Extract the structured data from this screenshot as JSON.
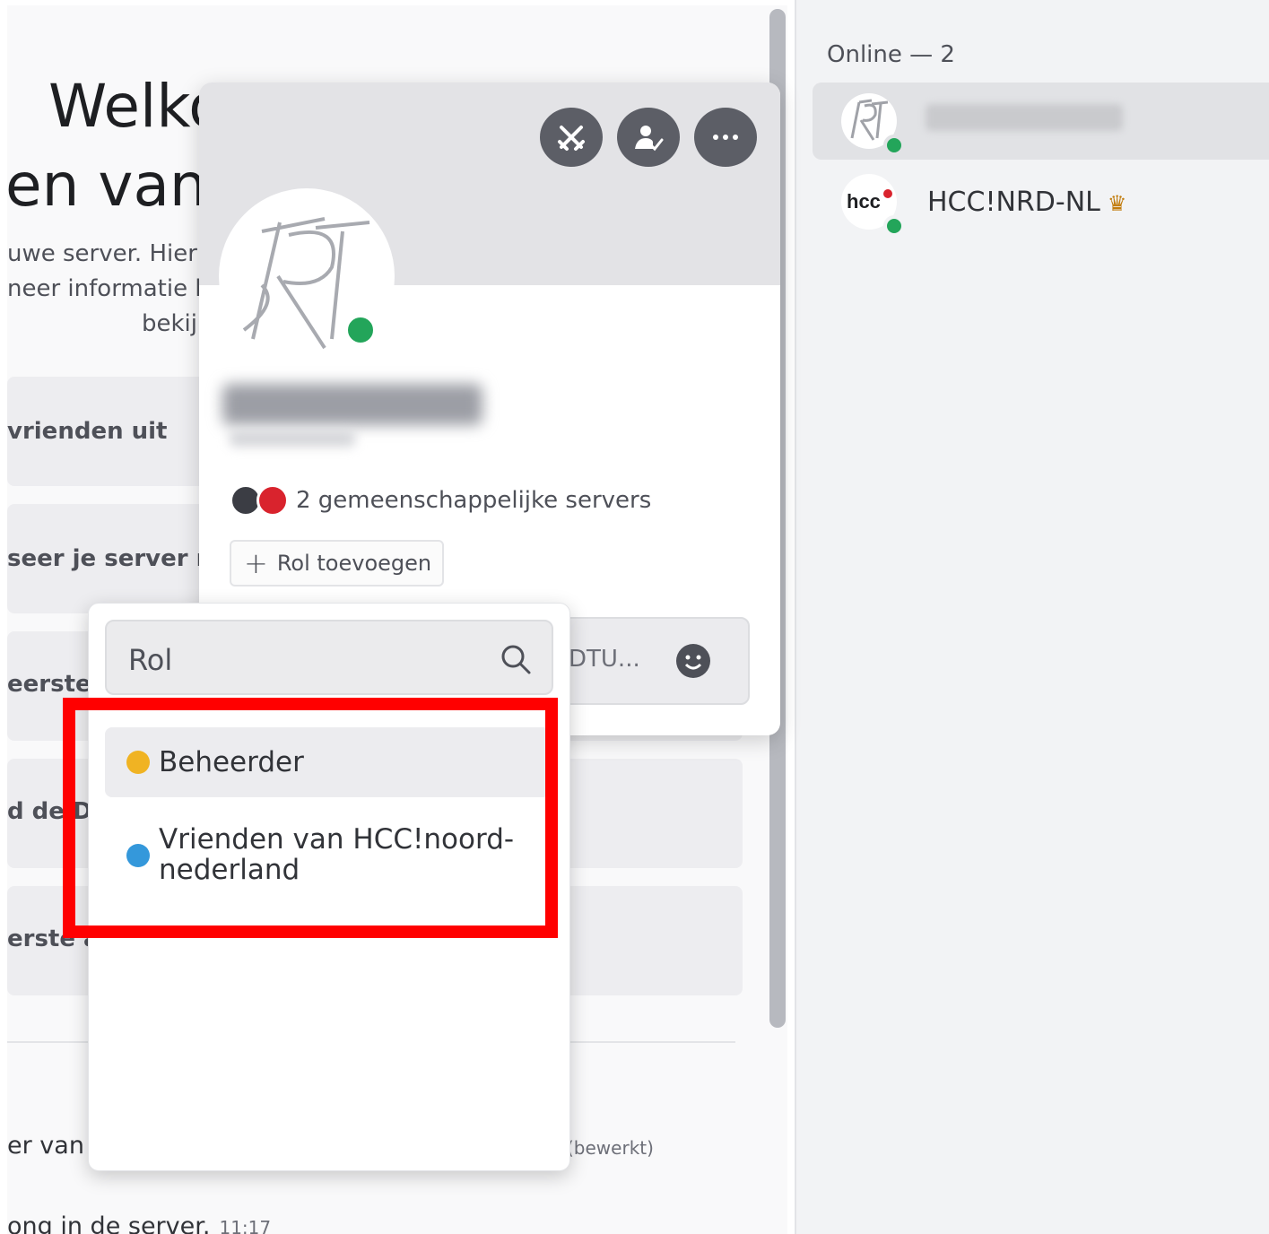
{
  "main": {
    "welcome_title_line1": "Welko",
    "welcome_title_line2": "en van l",
    "welcome_desc_line1": "uwe server. Hier v",
    "welcome_desc_line2": "neer informatie k",
    "welcome_desc_line3": "bekijl",
    "cards": [
      {
        "label": "vrienden uit"
      },
      {
        "label": "seer je server m"
      },
      {
        "label": "eerste b"
      },
      {
        "label": "d de Dis"
      },
      {
        "label": "erste a"
      }
    ],
    "message_line1": "er van",
    "edited_label": "(bewerkt)",
    "message_line2": "ong in de server.",
    "message_time": "11:17"
  },
  "member_list": {
    "header": "Online — 2",
    "members": [
      {
        "name": "",
        "avatar_icon": "kt-logo-avatar",
        "status": "online",
        "selected": true
      },
      {
        "name": "HCC!NRD-NL",
        "avatar_icon": "hcc-logo-avatar",
        "status": "online",
        "owner_icon": "crown-icon"
      }
    ]
  },
  "profile": {
    "buttons": [
      {
        "icon": "swords-icon"
      },
      {
        "icon": "person-check-icon"
      },
      {
        "icon": "more-icon"
      }
    ],
    "mutual_servers": "2 gemeenschappelijke servers",
    "add_role_plus": "+",
    "add_role_label": "Rol toevoegen",
    "note_text": "DTU..."
  },
  "role_dropdown": {
    "search_value": "Rol",
    "roles": [
      {
        "label": "Beheerder",
        "color": "#f0b323"
      },
      {
        "label_line1": "Vrienden van HCC!noord-",
        "label_line2": "nederland",
        "color": "#3498db"
      }
    ]
  },
  "colors": {
    "online": "#23a55a",
    "highlight": "#ff0000",
    "crown": "#c27c0e"
  }
}
